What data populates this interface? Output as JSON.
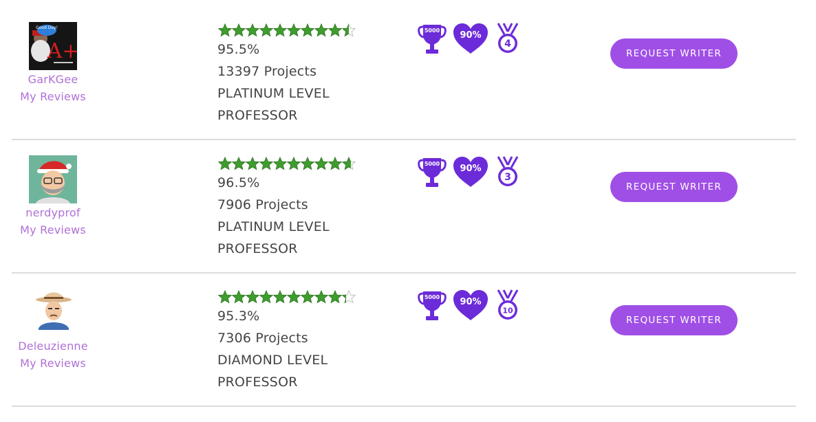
{
  "colors": {
    "accent": "#a04fe6",
    "badge": "#6c2bd9",
    "star": "#3f9c2e",
    "link": "#b070d8"
  },
  "writers": [
    {
      "name": "GarKGee",
      "reviews_label": "My Reviews",
      "avatar_icon": "santa-collage-avatar",
      "avatar_texts": [
        "Good Day!",
        "A+"
      ],
      "stars_rating": 9.5,
      "rating": "95.5%",
      "projects": "13397 Projects",
      "level": "PLATINUM LEVEL",
      "title": "PROFESSOR",
      "badges": {
        "trophy": "5000",
        "heart": "90%",
        "medal": "4"
      },
      "action": "REQUEST WRITER"
    },
    {
      "name": "nerdyprof",
      "reviews_label": "My Reviews",
      "avatar_icon": "bearded-man-santa-hat-avatar",
      "stars_rating": 9.65,
      "rating": "96.5%",
      "projects": "7906 Projects",
      "level": "PLATINUM LEVEL",
      "title": "PROFESSOR",
      "badges": {
        "trophy": "5000",
        "heart": "90%",
        "medal": "3"
      },
      "action": "REQUEST WRITER"
    },
    {
      "name": "Deleuzienne",
      "reviews_label": "My Reviews",
      "avatar_icon": "cowboy-hat-man-avatar",
      "stars_rating": 9.3,
      "rating": "95.3%",
      "projects": "7306 Projects",
      "level": "DIAMOND LEVEL",
      "title": "PROFESSOR",
      "badges": {
        "trophy": "5000",
        "heart": "90%",
        "medal": "10"
      },
      "action": "REQUEST WRITER"
    }
  ]
}
